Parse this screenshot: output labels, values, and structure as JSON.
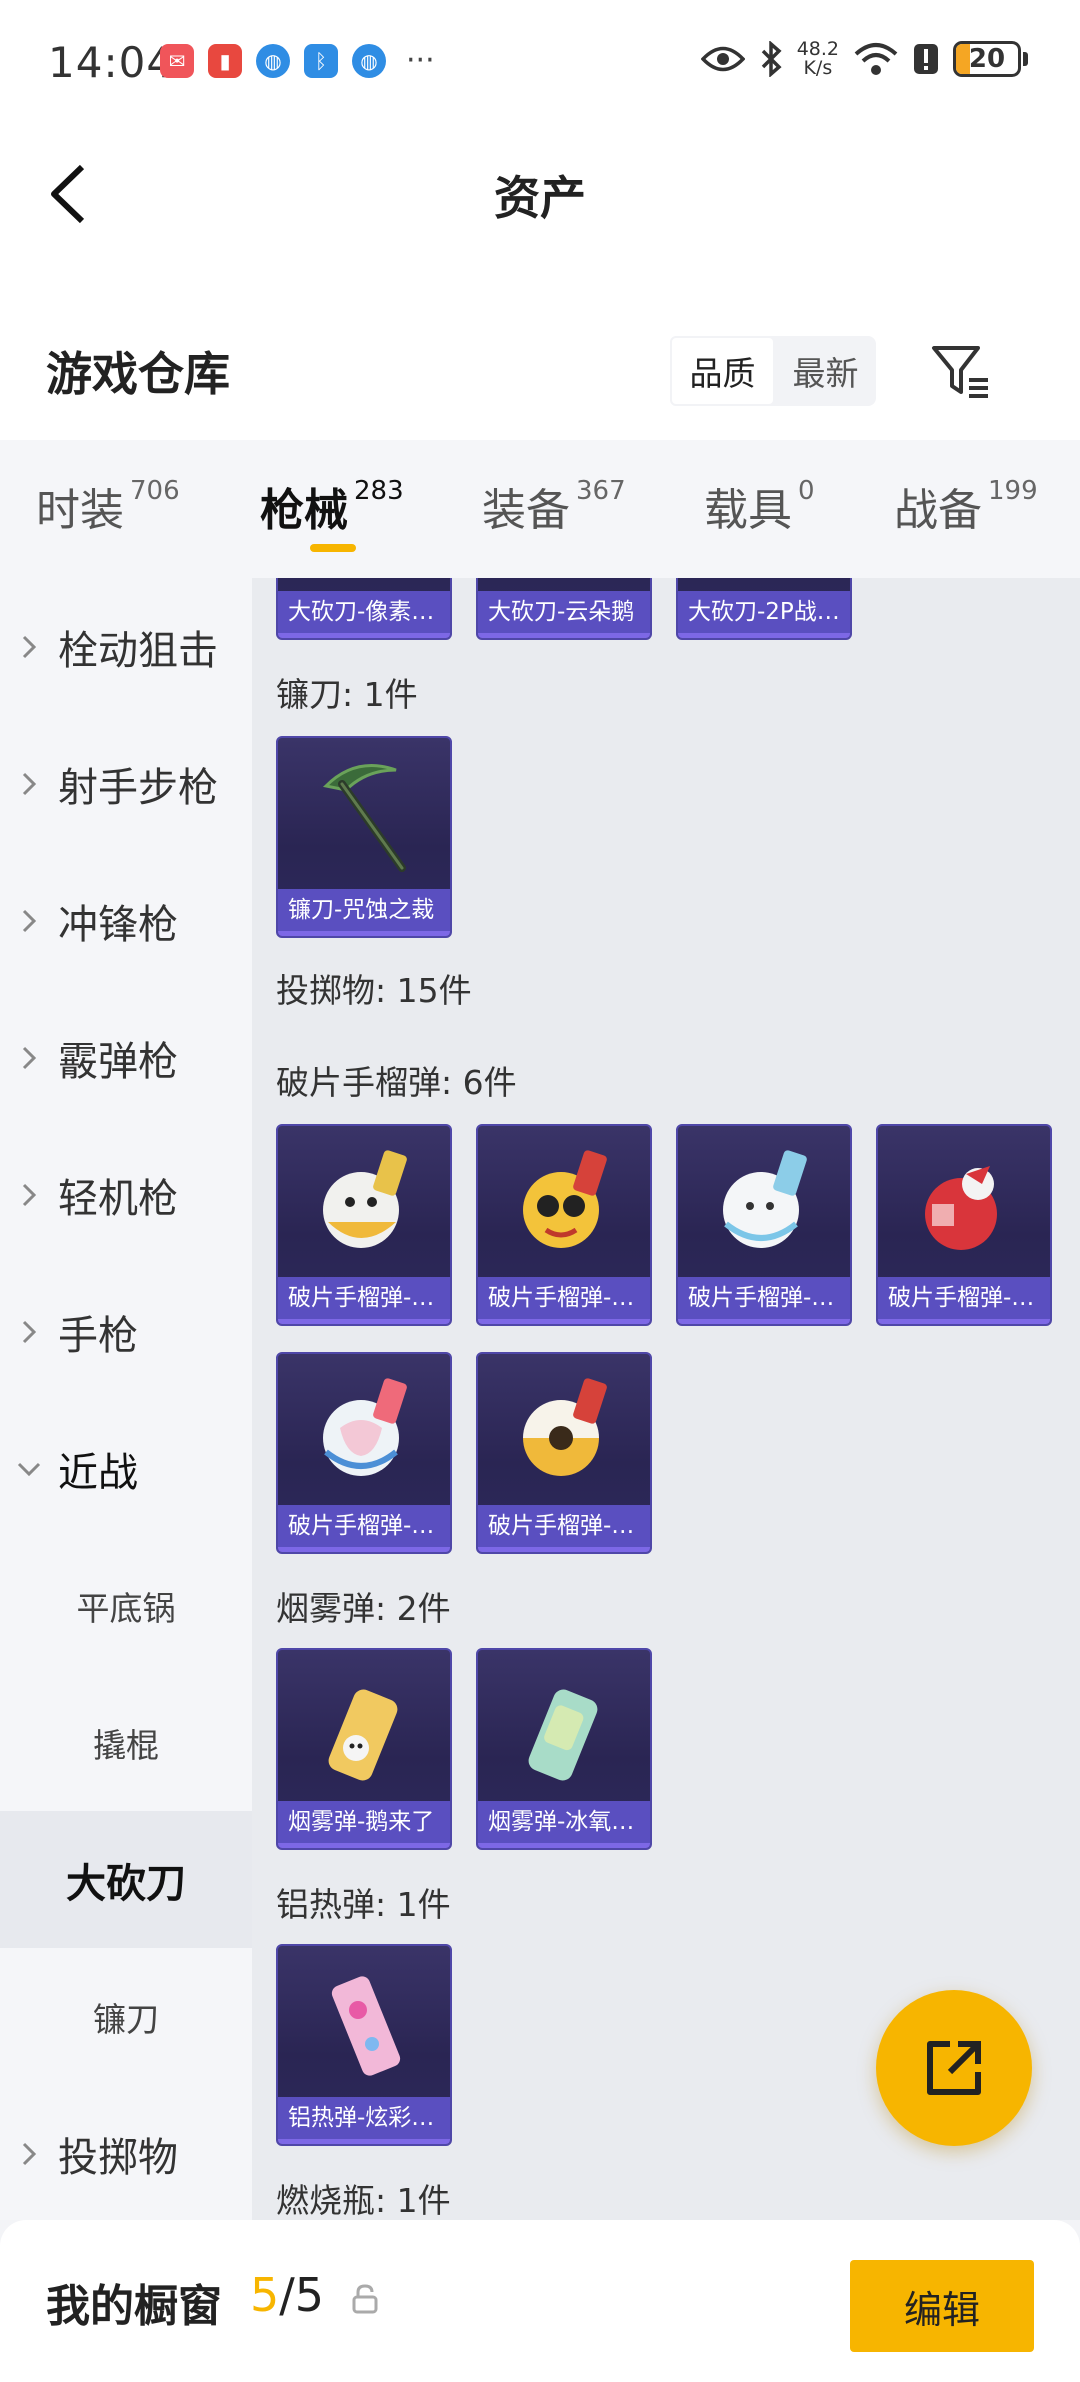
{
  "status_bar": {
    "time": "14:04",
    "net_speed_value": "48.2",
    "net_speed_unit": "K/s",
    "battery_level": "20",
    "overflow": "···"
  },
  "header": {
    "title": "资产",
    "section_title": "游戏仓库",
    "sort_options": [
      "品质",
      "最新"
    ],
    "active_sort": "品质"
  },
  "tabs": [
    {
      "label": "时装",
      "count": "706"
    },
    {
      "label": "枪械",
      "count": "283",
      "active": true
    },
    {
      "label": "装备",
      "count": "367"
    },
    {
      "label": "载具",
      "count": "0"
    },
    {
      "label": "战备",
      "count": "199"
    }
  ],
  "sidebar": {
    "items": [
      {
        "label": "栓动狙击",
        "type": "category"
      },
      {
        "label": "射手步枪",
        "type": "category"
      },
      {
        "label": "冲锋枪",
        "type": "category"
      },
      {
        "label": "霰弹枪",
        "type": "category"
      },
      {
        "label": "轻机枪",
        "type": "category"
      },
      {
        "label": "手枪",
        "type": "category"
      },
      {
        "label": "近战",
        "type": "category",
        "expanded": true
      },
      {
        "label": "平底锅",
        "type": "sub"
      },
      {
        "label": "撬棍",
        "type": "sub"
      },
      {
        "label": "大砍刀",
        "type": "sub",
        "selected": true
      },
      {
        "label": "镰刀",
        "type": "sub"
      },
      {
        "label": "投掷物",
        "type": "category"
      }
    ]
  },
  "content": {
    "top_row": [
      "大砍刀-像素…",
      "大砍刀-云朵鹅",
      "大砍刀-2P战…"
    ],
    "groups": [
      {
        "title": "镰刀: 1件",
        "items": [
          "镰刀-咒蚀之裁"
        ]
      },
      {
        "title": "投掷物: 15件",
        "items": []
      },
      {
        "title": "破片手榴弹: 6件",
        "items": [
          "破片手榴弹-…",
          "破片手榴弹-…",
          "破片手榴弹-…",
          "破片手榴弹-…",
          "破片手榴弹-…",
          "破片手榴弹-…"
        ]
      },
      {
        "title": "烟雾弹: 2件",
        "items": [
          "烟雾弹-鹅来了",
          "烟雾弹-冰氧…"
        ]
      },
      {
        "title": "铝热弹: 1件",
        "items": [
          "铝热弹-炫彩…"
        ]
      },
      {
        "title": "燃烧瓶: 1件",
        "items": []
      }
    ]
  },
  "bottom_bar": {
    "label": "我的橱窗",
    "current": "5",
    "separator": "/",
    "total": "5",
    "edit_label": "编辑"
  },
  "colors": {
    "accent": "#f7b500",
    "card_bg": "#2a2553",
    "card_label_bg": "#5a4fc0"
  },
  "icons": [
    "back-arrow-icon",
    "filter-icon",
    "chevron-right-icon",
    "chevron-down-icon",
    "share-icon",
    "lock-icon",
    "eye-icon",
    "bluetooth-icon",
    "wifi-icon",
    "battery-icon"
  ]
}
